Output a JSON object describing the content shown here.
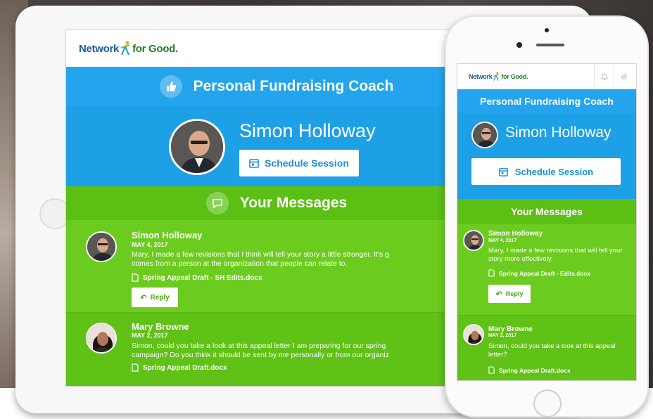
{
  "brand": {
    "logo_left": "Network",
    "logo_right": "for Good."
  },
  "tablet": {
    "coach_title": "Personal Fundraising Coach",
    "coach_name": "Simon Holloway",
    "schedule_label": "Schedule Session",
    "messages_title": "Your Messages",
    "messages": [
      {
        "author": "Simon Holloway",
        "date": "MAY 4, 2017",
        "text_line1": "Mary, I made a few revisions that I think will tell your story a little stronger. It's g",
        "text_line2": "comes from a person at the organization that people can relate to.",
        "attachment": "Spring Appeal Draft - SH Edits.docx",
        "reply_label": "Reply"
      },
      {
        "author": "Mary Browne",
        "date": "MAY 2, 2017",
        "text_line1": "Simon, could you take a look at this appeal letter I am preparing for our spring",
        "text_line2": "campaign? Do you think it should be sent by me personally or from our organiz",
        "attachment": "Spring Appeal Draft.docx"
      }
    ]
  },
  "phone": {
    "coach_title": "Personal Fundraising Coach",
    "coach_name": "Simon Holloway",
    "schedule_label": "Schedule Session",
    "messages_title": "Your Messages",
    "messages": [
      {
        "author": "Simon Holloway",
        "date": "MAY 4, 2017",
        "text": "Mary, I made a few revisions that will tell your story more effectively.",
        "attachment": "Spring Appeal Draft - Edits.docx",
        "reply_label": "Reply"
      },
      {
        "author": "Mary Browne",
        "date": "MAY 2, 2017",
        "text": "Simon, could you take a look at this appeal letter?",
        "attachment": "Spring Appeal Draft.docx"
      }
    ]
  },
  "colors": {
    "blue": "#23a4ec",
    "green": "#5cbf14",
    "logo_blue": "#1f5c99"
  },
  "icons": [
    "thumbs-up-icon",
    "chat-bubble-icon",
    "calendar-icon",
    "document-icon",
    "reply-arrow-icon",
    "bell-icon",
    "gear-icon"
  ]
}
